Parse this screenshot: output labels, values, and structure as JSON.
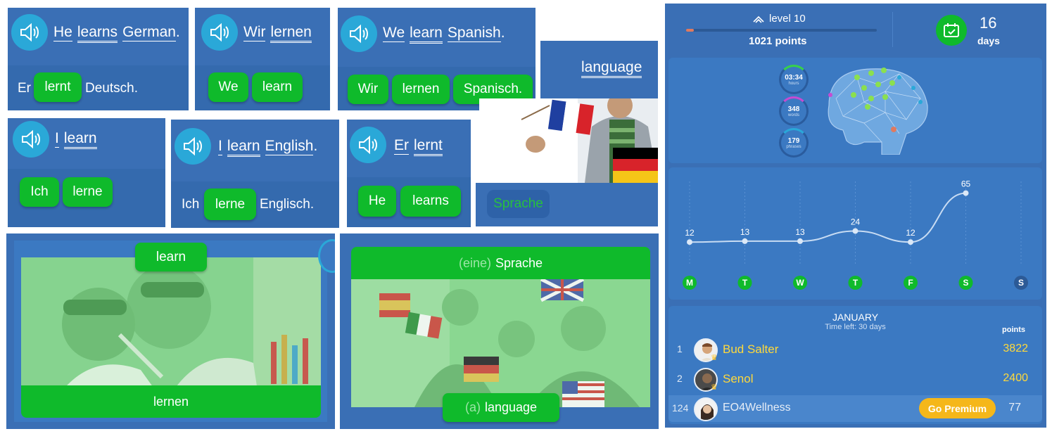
{
  "cards": {
    "c1": {
      "sentence": [
        "He",
        "learns",
        "German",
        "."
      ],
      "prefix": "Er",
      "chips": [
        "lernt"
      ],
      "suffix": "Deutsch."
    },
    "c2": {
      "sentence": [
        "Wir",
        "lernen"
      ],
      "chips": [
        "We",
        "learn"
      ]
    },
    "c3": {
      "sentence": [
        "We",
        "learn",
        "Spanish",
        "."
      ],
      "chips": [
        "Wir",
        "lernen",
        "Spanisch."
      ]
    },
    "c4": {
      "word": "language"
    },
    "c5": {
      "sentence": [
        "I",
        "learn"
      ],
      "chips": [
        "Ich",
        "lerne"
      ]
    },
    "c6": {
      "sentence": [
        "I",
        "learn",
        "English",
        "."
      ],
      "prefix": "Ich",
      "chips": [
        "lerne"
      ],
      "suffix": "Englisch."
    },
    "c7": {
      "sentence": [
        "Er",
        "lernt"
      ],
      "chips": [
        "He",
        "learns"
      ]
    },
    "c8": {
      "chip": "Sprache"
    },
    "c9": {
      "top_chip": "learn",
      "bottom_label": "lernen"
    },
    "c10": {
      "top_article": "(eine)",
      "top_word": "Sprache",
      "bottom_article": "(a)",
      "bottom_word": "language"
    }
  },
  "stats": {
    "level": "level 10",
    "level_progress": 0.04,
    "points": "1021 points",
    "days_count": "16",
    "days_label": "days",
    "hours": "03:34",
    "hours_label": "hours",
    "hours_progress": 0.25,
    "words": "348",
    "words_label": "words",
    "words_progress": 0.3,
    "phrases": "179",
    "phrases_label": "phrases",
    "phrases_progress": 0.2,
    "accent_green": "#0fba2b",
    "accent_yellow": "#ffd93b"
  },
  "chart_data": {
    "type": "line",
    "categories": [
      "M",
      "T",
      "W",
      "T",
      "F",
      "S",
      "S"
    ],
    "values": [
      12,
      13,
      13,
      24,
      12,
      65,
      null
    ],
    "ylim": [
      0,
      70
    ],
    "grid": true
  },
  "leaderboard": {
    "month": "JANUARY",
    "time_left": "Time left: 30 days",
    "points_header": "points",
    "rows": [
      {
        "rank": "1",
        "name": "Bud Salter",
        "points": "3822"
      },
      {
        "rank": "2",
        "name": "Senol",
        "points": "2400"
      },
      {
        "rank": "124",
        "name": "EO4Wellness",
        "points": "77",
        "button": "Go Premium"
      }
    ]
  }
}
